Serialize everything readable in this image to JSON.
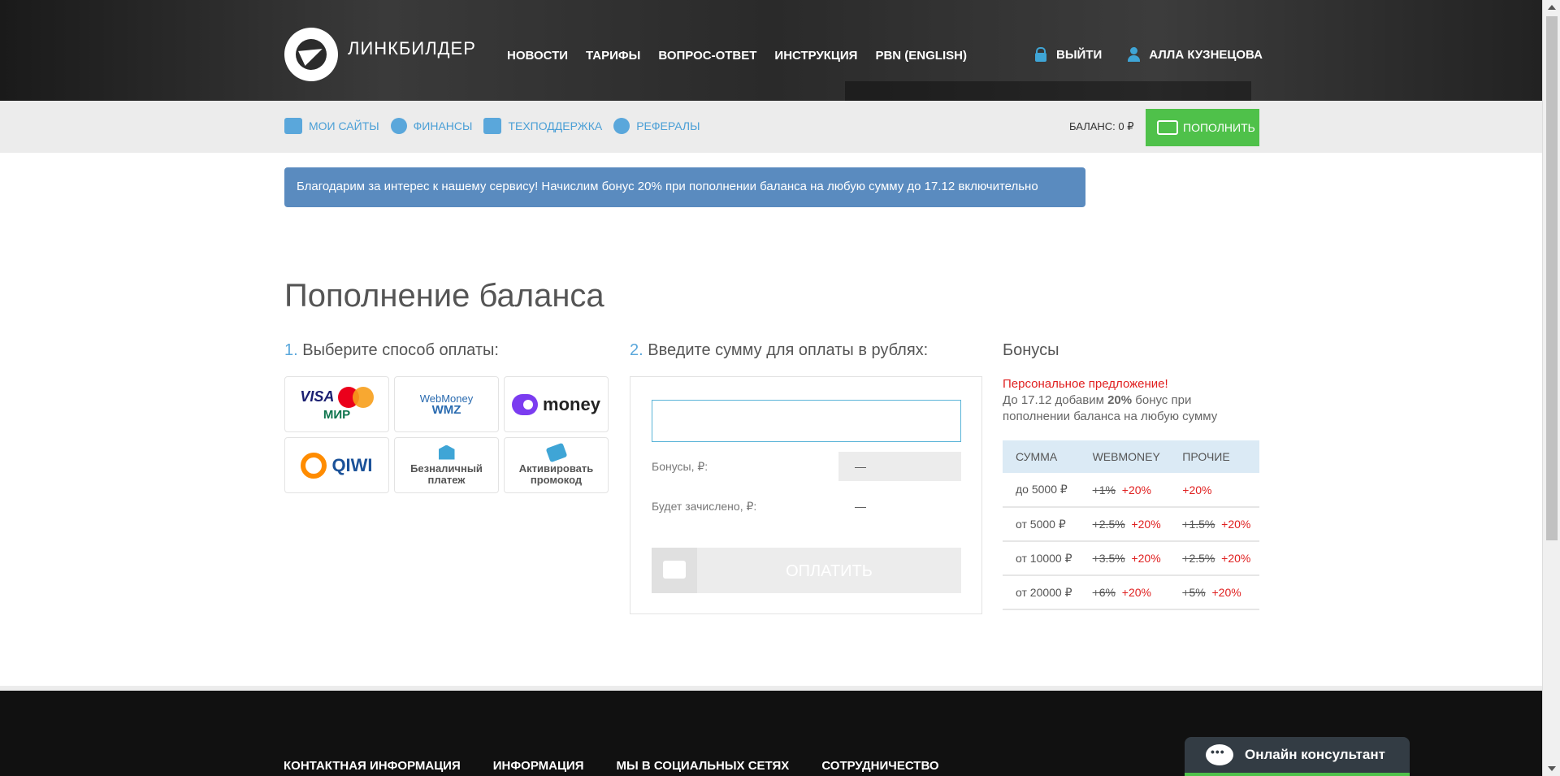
{
  "header": {
    "logo_text": "ЛИНКБИЛДЕР",
    "nav": [
      "НОВОСТИ",
      "ТАРИФЫ",
      "ВОПРОС-ОТВЕТ",
      "ИНСТРУКЦИЯ",
      "PBN (ENGLISH)"
    ],
    "logout_label": "ВЫЙТИ",
    "user_name": "АЛЛА КУЗНЕЦОВА"
  },
  "subnav": {
    "items": [
      "МОИ САЙТЫ",
      "ФИНАНСЫ",
      "ТЕХПОДДЕРЖКА",
      "РЕФЕРАЛЫ"
    ],
    "balance": "БАЛАНС: 0 ₽",
    "topup_label": "ПОПОЛНИТЬ"
  },
  "banner": "Благодарим за интерес к нашему сервису! Начислим бонус 20% при пополнении баланса на любую сумму до 17.12 включительно",
  "page_title": "Пополнение баланса",
  "step1": {
    "num": "1.",
    "text": "Выберите способ оплаты:"
  },
  "step2": {
    "num": "2.",
    "text": "Введите сумму для оплаты в рублях:"
  },
  "payment_methods": {
    "visa": "VISA",
    "mir": "МИР",
    "webmoney_top": "WebMoney",
    "webmoney_bottom": "WMZ",
    "yoomoney": "money",
    "qiwi": "QIWI",
    "bank_line1": "Безналичный",
    "bank_line2": "платеж",
    "promo_line1": "Активировать",
    "promo_line2": "промокод"
  },
  "amount": {
    "input_value": "",
    "bonus_label": "Бонусы, ₽:",
    "bonus_value": "—",
    "credited_label": "Будет зачислено, ₽:",
    "credited_value": "—",
    "pay_label": "ОПЛАТИТЬ"
  },
  "bonuses": {
    "title": "Бонусы",
    "personal": "Персональное предложение!",
    "desc_pre": "До 17.12 добавим ",
    "desc_bold": "20%",
    "desc_post": " бонус при пополнении баланса на любую сумму",
    "headers": [
      "СУММА",
      "WEBMONEY",
      "ПРОЧИЕ"
    ],
    "rows": [
      {
        "sum": "до 5000 ₽",
        "wm_old": "+1%",
        "wm_new": "+20%",
        "other_old": "",
        "other_new": "+20%"
      },
      {
        "sum": "от 5000 ₽",
        "wm_old": "+2.5%",
        "wm_new": "+20%",
        "other_old": "+1.5%",
        "other_new": "+20%"
      },
      {
        "sum": "от 10000 ₽",
        "wm_old": "+3.5%",
        "wm_new": "+20%",
        "other_old": "+2.5%",
        "other_new": "+20%"
      },
      {
        "sum": "от 20000 ₽",
        "wm_old": "+6%",
        "wm_new": "+20%",
        "other_old": "+5%",
        "other_new": "+20%"
      }
    ]
  },
  "footer": {
    "nav": [
      "КОНТАКТНАЯ ИНФОРМАЦИЯ",
      "ИНФОРМАЦИЯ",
      "МЫ В СОЦИАЛЬНЫХ СЕТЯХ",
      "СОТРУДНИЧЕСТВО"
    ],
    "chat_label": "Онлайн консультант"
  },
  "colors": {
    "accent": "#5aa7db",
    "green": "#4fc14a",
    "red": "#e02020",
    "banner": "#5a8bbf"
  }
}
